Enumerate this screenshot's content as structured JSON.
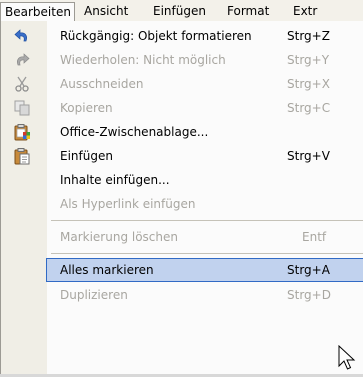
{
  "menubar": {
    "items": [
      {
        "label": "Bearbeiten",
        "active": true
      },
      {
        "label": "Ansicht"
      },
      {
        "label": "Einfügen"
      },
      {
        "label": "Format"
      },
      {
        "label": "Extr"
      }
    ]
  },
  "menu": {
    "items": [
      {
        "label": "Rückgängig: Objekt formatieren",
        "shortcut": "Strg+Z",
        "icon": "undo-icon",
        "enabled": true
      },
      {
        "label": "Wiederholen: Nicht möglich",
        "shortcut": "Strg+Y",
        "icon": "redo-icon",
        "enabled": false
      },
      {
        "label": "Ausschneiden",
        "shortcut": "Strg+X",
        "icon": "cut-icon",
        "enabled": false
      },
      {
        "label": "Kopieren",
        "shortcut": "Strg+C",
        "icon": "copy-icon",
        "enabled": false
      },
      {
        "label": "Office-Zwischenablage...",
        "shortcut": "",
        "icon": "office-clipboard-icon",
        "enabled": true
      },
      {
        "label": "Einfügen",
        "shortcut": "Strg+V",
        "icon": "paste-icon",
        "enabled": true
      },
      {
        "label": "Inhalte einfügen...",
        "shortcut": "",
        "enabled": true
      },
      {
        "label": "Als Hyperlink einfügen",
        "shortcut": "",
        "enabled": false
      },
      {
        "label": "Markierung löschen",
        "shortcut": "Entf",
        "enabled": false
      },
      {
        "label": "Alles markieren",
        "shortcut": "Strg+A",
        "enabled": true,
        "highlighted": true
      },
      {
        "label": "Duplizieren",
        "shortcut": "Strg+D",
        "enabled": false
      }
    ]
  },
  "colors": {
    "highlight": "#c1d2ee",
    "highlight_border": "#316ac5",
    "disabled_text": "#a8a6a0"
  },
  "cursor": "arrow-cursor-icon"
}
